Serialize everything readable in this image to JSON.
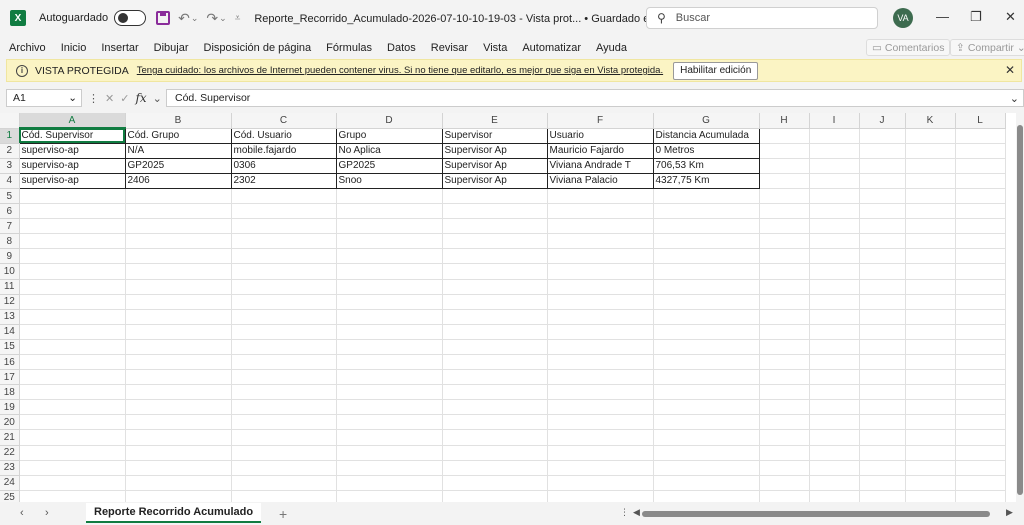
{
  "titlebar": {
    "app_logo": "X",
    "autosave_label": "Autoguardado",
    "doc_title": "Reporte_Recorrido_Acumulado-2026-07-10-10-19-03  -  Vista prot... • Guardado en Este PC ⌄",
    "search_placeholder": "Buscar",
    "avatar_initials": "VA"
  },
  "menu": {
    "items": [
      "Archivo",
      "Inicio",
      "Insertar",
      "Dibujar",
      "Disposición de página",
      "Fórmulas",
      "Datos",
      "Revisar",
      "Vista",
      "Automatizar",
      "Ayuda"
    ],
    "comments_label": "Comentarios",
    "share_label": "Compartir"
  },
  "protected": {
    "title": "VISTA PROTEGIDA",
    "message": "Tenga cuidado: los archivos de Internet pueden contener virus. Si no tiene que editarlo, es mejor que siga en Vista protegida.",
    "enable_label": "Habilitar edición"
  },
  "formula": {
    "cell_ref": "A1",
    "fx_label": "fx",
    "content": "Cód. Supervisor"
  },
  "sheet": {
    "columns": [
      "A",
      "B",
      "C",
      "D",
      "E",
      "F",
      "G",
      "H",
      "I",
      "J",
      "K",
      "L"
    ],
    "headers": [
      "Cód. Supervisor",
      "Cód. Grupo",
      "Cód. Usuario",
      "Grupo",
      "Supervisor",
      "Usuario",
      "Distancia Acumulada"
    ],
    "rows": [
      [
        "superviso-ap",
        "N/A",
        "mobile.fajardo",
        "No Aplica",
        "Supervisor Ap",
        "Mauricio Fajardo",
        "0 Metros"
      ],
      [
        "superviso-ap",
        "GP2025",
        "0306",
        "GP2025",
        "Supervisor Ap",
        "Viviana Andrade T",
        "706,53 Km"
      ],
      [
        "superviso-ap",
        "2406",
        "2302",
        "Snoo",
        "Supervisor Ap",
        "Viviana Palacio",
        "4327,75 Km"
      ]
    ],
    "row_count": 25
  },
  "tabs": {
    "active_sheet": "Reporte Recorrido Acumulado",
    "add_label": "+"
  }
}
